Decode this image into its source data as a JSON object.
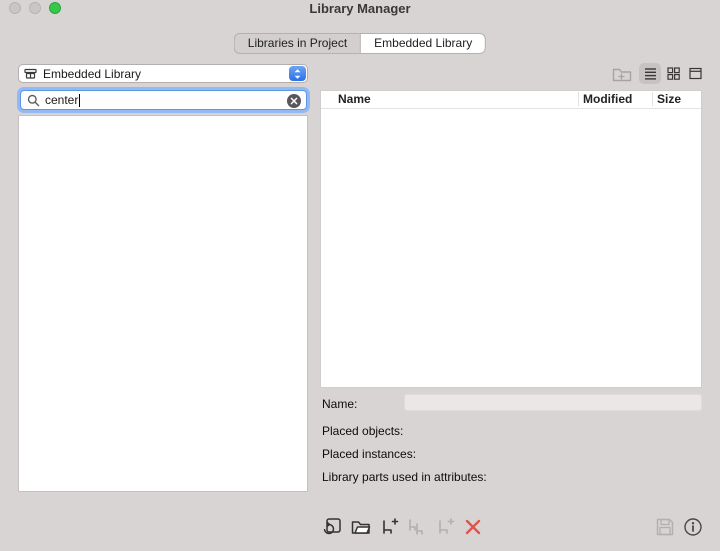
{
  "window": {
    "title": "Library Manager"
  },
  "tabs": {
    "items": [
      {
        "label": "Libraries in Project",
        "selected": false
      },
      {
        "label": "Embedded Library",
        "selected": true
      }
    ]
  },
  "left_panel": {
    "library_dropdown": {
      "value": "Embedded Library"
    },
    "search": {
      "value": "center",
      "placeholder": ""
    },
    "list": {
      "rows": []
    }
  },
  "right_panel": {
    "view_toolbar": {
      "selected_view": "list"
    },
    "table": {
      "columns": [
        {
          "label": "Name"
        },
        {
          "label": "Modified"
        },
        {
          "label": "Size"
        }
      ],
      "rows": []
    },
    "details": {
      "name_label": "Name:",
      "name_value": "",
      "placed_objects_label": "Placed objects:",
      "placed_objects_value": "",
      "placed_instances_label": "Placed instances:",
      "placed_instances_value": "",
      "library_parts_label": "Library parts used in attributes:",
      "library_parts_value": ""
    }
  },
  "colors": {
    "accent_blue": "#2e6fe4",
    "focus_ring_blue": "#93b9f3",
    "delete_red": "#e0544a",
    "traffic_light_green": "#35c84b",
    "traffic_light_gray": "#c9c6c5",
    "window_background": "#d8d4d3"
  },
  "icons": {
    "close": "gray-circle",
    "minimize": "gray-circle",
    "zoom": "green-circle",
    "library_dropdown": "embedded-library-glyph",
    "search": "magnifier",
    "clear_search": "x-in-dark-circle",
    "new_folder": "folder-outline",
    "list_view": "horizontal-lines",
    "grid_view": "2x2-squares",
    "single_view": "window-outline",
    "add_library": "square-with-reload-arrow",
    "open_library": "open-folder-arrow",
    "add_object": "chair-with-plus",
    "duplicate_object": "two-chairs",
    "add_instance": "chair-with-plus-disabled",
    "delete": "red-x",
    "save": "floppy-disk",
    "info": "i-in-circle"
  }
}
